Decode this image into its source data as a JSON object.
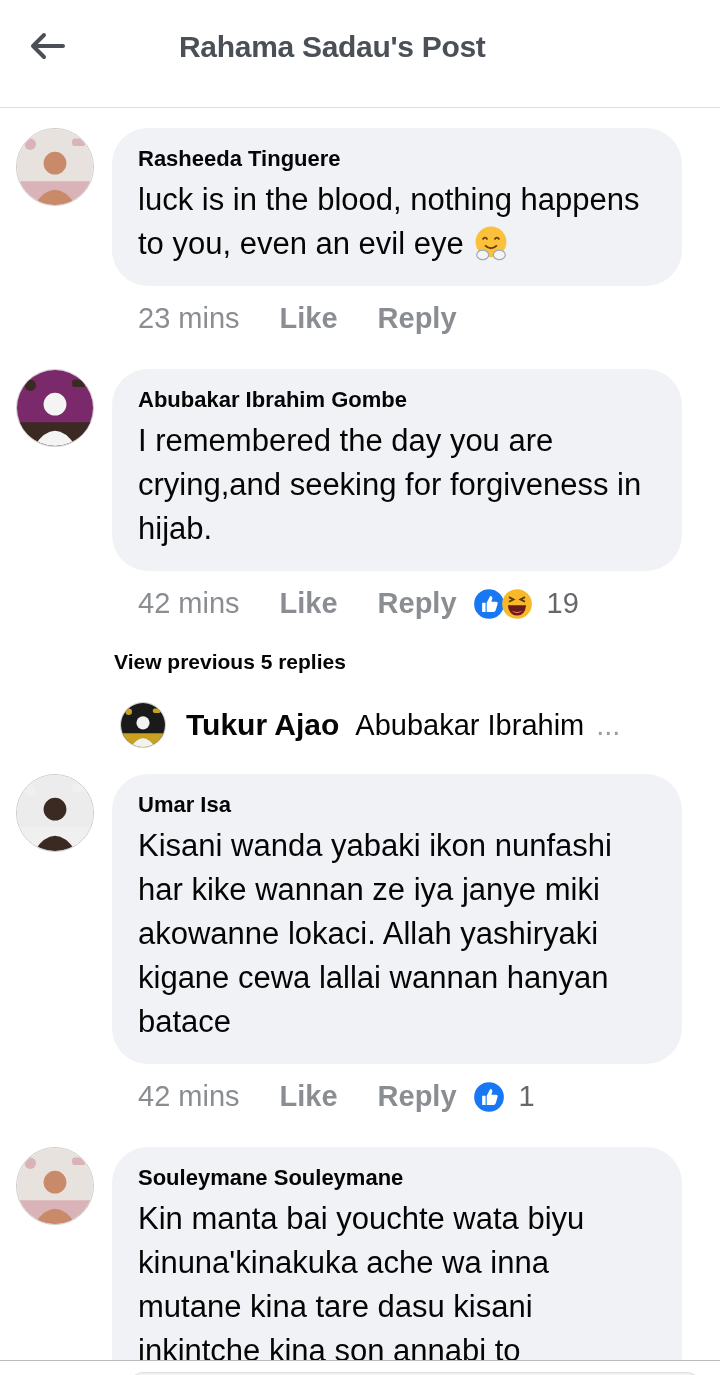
{
  "header": {
    "title": "Rahama Sadau's Post"
  },
  "items": [
    {
      "kind": "comment",
      "author": "Rasheeda Tinguere",
      "text": "luck is in the blood, nothing happens to you, even an evil eye",
      "emoji": {
        "kind": "hug"
      },
      "time": "23 mins",
      "actions": [
        "Like",
        "Reply"
      ]
    },
    {
      "kind": "comment",
      "author": "Abubakar Ibrahim Gombe",
      "text": "I remembered the day you are crying,and seeking for forgiveness in hijab.",
      "time": "42 mins",
      "actions": [
        "Like",
        "Reply"
      ],
      "reactions": {
        "types": [
          {
            "kind": "like"
          },
          {
            "kind": "haha"
          }
        ],
        "count": "19"
      }
    },
    {
      "kind": "more",
      "label": "View previous 5 replies"
    },
    {
      "kind": "reply_preview",
      "author": "Tukur Ajao",
      "text": "Abubakar Ibrahim",
      "ellipsis": "..."
    },
    {
      "kind": "comment",
      "author": "Umar Isa",
      "text": "Kisani wanda yabaki ikon nunfashi har kike wannan ze iya janye miki akowanne lokaci. Allah yashiryaki kigane cewa lallai wannan hanyan batace",
      "time": "42 mins",
      "actions": [
        "Like",
        "Reply"
      ],
      "reactions": {
        "types": [
          {
            "kind": "like"
          }
        ],
        "count": "1"
      }
    },
    {
      "kind": "comment",
      "author": "Souleymane Souleymane",
      "text": "Kin manta bai youchte wata biyu kinuna'kinakuka ache wa inna mutane kina tare dasu kisani inkintche kina son annabi to"
    }
  ]
}
